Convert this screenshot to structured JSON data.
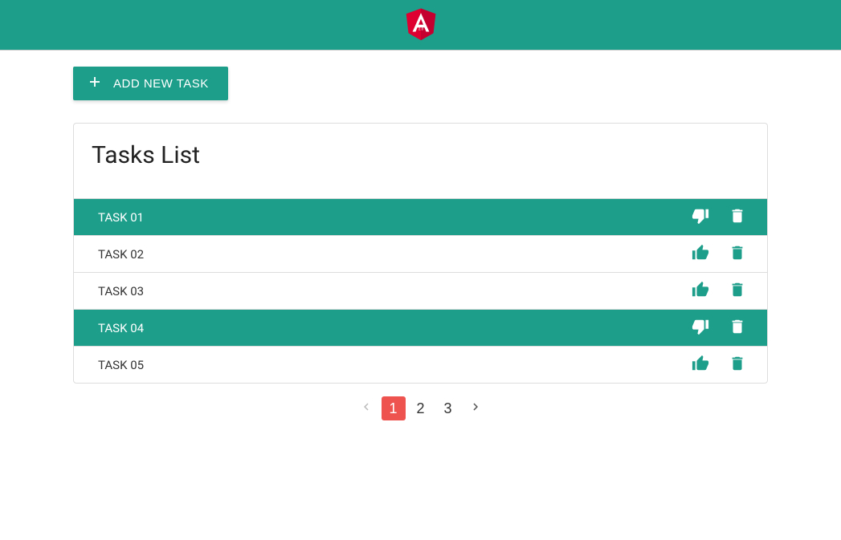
{
  "header": {
    "add_button_label": "ADD NEW TASK"
  },
  "card": {
    "title": "Tasks List"
  },
  "tasks": [
    {
      "label": "TASK 01",
      "selected": true
    },
    {
      "label": "TASK 02",
      "selected": false
    },
    {
      "label": "TASK 03",
      "selected": false
    },
    {
      "label": "TASK 04",
      "selected": true
    },
    {
      "label": "TASK 05",
      "selected": false
    }
  ],
  "pagination": {
    "pages": [
      "1",
      "2",
      "3"
    ],
    "active": "1",
    "prev_disabled": true
  },
  "colors": {
    "primary": "#1d9e8a",
    "accent": "#ef5350"
  }
}
